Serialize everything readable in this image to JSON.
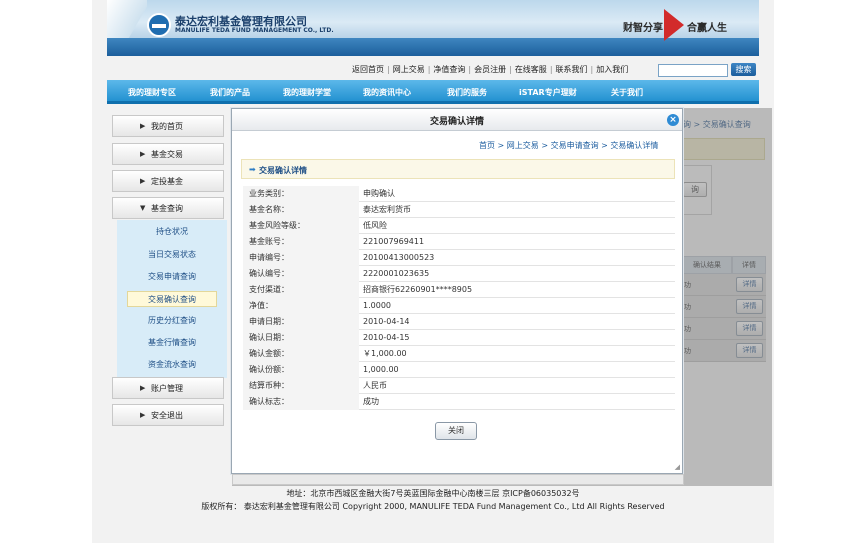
{
  "header": {
    "company_cn": "泰达宏利基金管理有限公司",
    "company_en": "MANULIFE TEDA FUND MANAGEMENT CO., LTD.",
    "slogan_left": "财智分享",
    "slogan_right": "合赢人生"
  },
  "toplinks": [
    "返回首页",
    "网上交易",
    "净值查询",
    "会员注册",
    "在线客服",
    "联系我们",
    "加入我们"
  ],
  "search": {
    "button": "搜索",
    "value": ""
  },
  "nav": [
    "我的理财专区",
    "我们的产品",
    "我的理财学堂",
    "我的资讯中心",
    "我们的服务",
    "iSTAR专户理财",
    "关于我们"
  ],
  "sidebar": {
    "items": [
      {
        "label": "我的首页",
        "tri": "▶"
      },
      {
        "label": "基金交易",
        "tri": "▶"
      },
      {
        "label": "定投基金",
        "tri": "▶"
      },
      {
        "label": "基金查询",
        "tri": "▼"
      },
      {
        "label": "账户管理",
        "tri": "▶"
      },
      {
        "label": "安全退出",
        "tri": "▶"
      }
    ],
    "submenu": [
      "持仓状况",
      "当日交易状态",
      "交易申请查询",
      "交易确认查询",
      "历史分红查询",
      "基金行情查询",
      "资金流水查询"
    ],
    "active_sub": "交易确认查询"
  },
  "background": {
    "crumb": "询 > 交易确认查询",
    "search_btn": "询",
    "table_header": [
      "确认结果",
      "详情"
    ],
    "rows": [
      {
        "result": "功",
        "btn": "详情"
      },
      {
        "result": "功",
        "btn": "详情"
      },
      {
        "result": "功",
        "btn": "详情"
      },
      {
        "result": "功",
        "btn": "详情"
      }
    ]
  },
  "dialog": {
    "title": "交易确认详情",
    "crumb": "首页  > 网上交易  > 交易申请查询  > 交易确认详情",
    "section_title": "交易确认详情",
    "rows": [
      {
        "k": "业务类别：",
        "v": "申购确认"
      },
      {
        "k": "基金名称：",
        "v": "泰达宏利货币"
      },
      {
        "k": "基金风险等级：",
        "v": "低风险"
      },
      {
        "k": "基金账号：",
        "v": "221007969411"
      },
      {
        "k": "申请编号：",
        "v": "20100413000523"
      },
      {
        "k": "确认编号：",
        "v": "2220001023635"
      },
      {
        "k": "支付渠道：",
        "v": "招商银行62260901****8905"
      },
      {
        "k": "净值：",
        "v": "1.0000"
      },
      {
        "k": "申请日期：",
        "v": "2010-04-14"
      },
      {
        "k": "确认日期：",
        "v": "2010-04-15"
      },
      {
        "k": "确认金额：",
        "v": "￥1,000.00"
      },
      {
        "k": "确认份额：",
        "v": "1,000.00"
      },
      {
        "k": "结算币种：",
        "v": "人民币"
      },
      {
        "k": "确认标志：",
        "v": "成功"
      }
    ],
    "close_button": "关闭"
  },
  "footer": {
    "address": "地址：北京市西城区金融大街7号英蓝国际金融中心南楼三层  京ICP备06035032号",
    "copyright": "版权所有：  泰达宏利基金管理有限公司  Copyright 2000, MANULIFE TEDA Fund Management Co., Ltd All Rights Reserved"
  }
}
